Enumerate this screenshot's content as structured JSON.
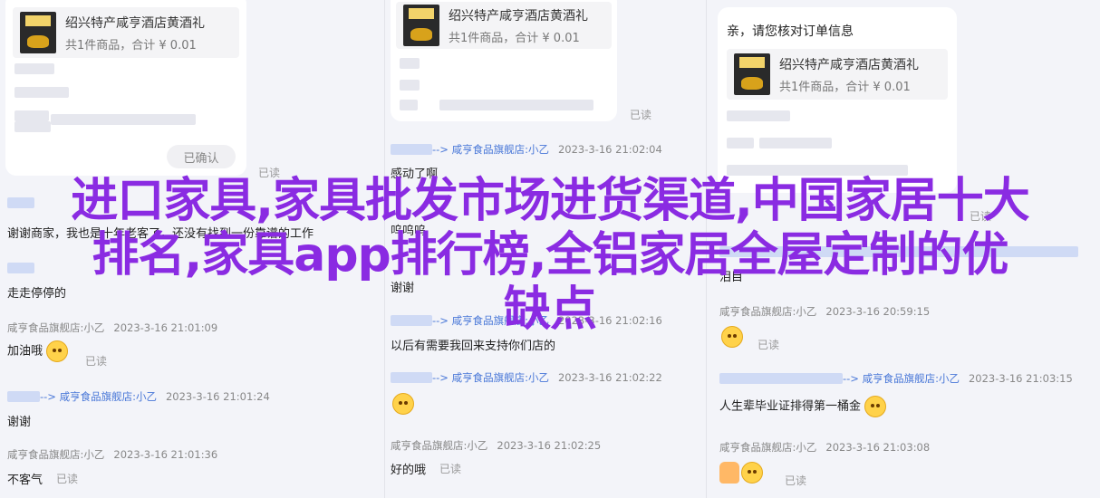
{
  "product": {
    "title": "绍兴特产咸亨酒店黄酒礼",
    "price": "共1件商品，合计 ¥ 0.01"
  },
  "col1": {
    "confirm_label": "已确认",
    "read_label": "已读",
    "messages": [
      {
        "text": "谢谢商家，我也是十年老客了，还没有找到一份靠谱的工作"
      },
      {
        "text": "走走停停的"
      },
      {
        "shop": "咸亨食品旗舰店:小乙",
        "time": "2023-3-16 21:01:09"
      },
      {
        "text": "加油哦"
      },
      {
        "arrow": "-->",
        "shop": "咸亨食品旗舰店:小乙",
        "time": "2023-3-16 21:01:24"
      },
      {
        "text": "谢谢"
      },
      {
        "shop": "咸亨食品旗舰店:小乙",
        "time": "2023-3-16 21:01:36"
      },
      {
        "text": "不客气"
      }
    ]
  },
  "col2": {
    "read_label": "已读",
    "messages": [
      {
        "arrow": "-->",
        "shop": "咸亨食品旗舰店:小乙",
        "time": "2023-3-16 21:02:04"
      },
      {
        "text": "感动了啊"
      },
      {
        "text": "呜呜呜"
      },
      {
        "text": "谢谢"
      },
      {
        "arrow": "-->",
        "shop": "咸亨食品旗舰店:小乙",
        "time": "2023-3-16 21:02:16"
      },
      {
        "text": "以后有需要我回来支持你们店的"
      },
      {
        "arrow": "-->",
        "shop": "咸亨食品旗舰店:小乙",
        "time": "2023-3-16 21:02:22"
      },
      {
        "shop": "咸亨食品旗舰店:小乙",
        "time": "2023-3-16 21:02:25"
      },
      {
        "text": "好的哦"
      }
    ]
  },
  "col3": {
    "greeting": "亲，请您核对订单信息",
    "read_label": "已读",
    "messages": [
      {
        "text": "泪目"
      },
      {
        "shop": "咸亨食品旗舰店:小乙",
        "time": "2023-3-16 20:59:15"
      },
      {
        "arrow": "-->",
        "shop": "咸亨食品旗舰店:小乙",
        "time": "2023-3-16 21:03:15"
      },
      {
        "text": "人生辈毕业证排得第一桶金"
      },
      {
        "shop": "咸亨食品旗舰店:小乙",
        "time": "2023-3-16 21:03:08"
      }
    ]
  },
  "overlay": {
    "line1": "进口家具,家具批发市场进货渠道,中国家居十大",
    "line2": "排名,家具app排行榜,全铝家居全屋定制的优",
    "line3": "缺点"
  },
  "colors": {
    "overlay": "#8a2be2",
    "link": "#4a78d8",
    "background": "#f3f4f9"
  }
}
